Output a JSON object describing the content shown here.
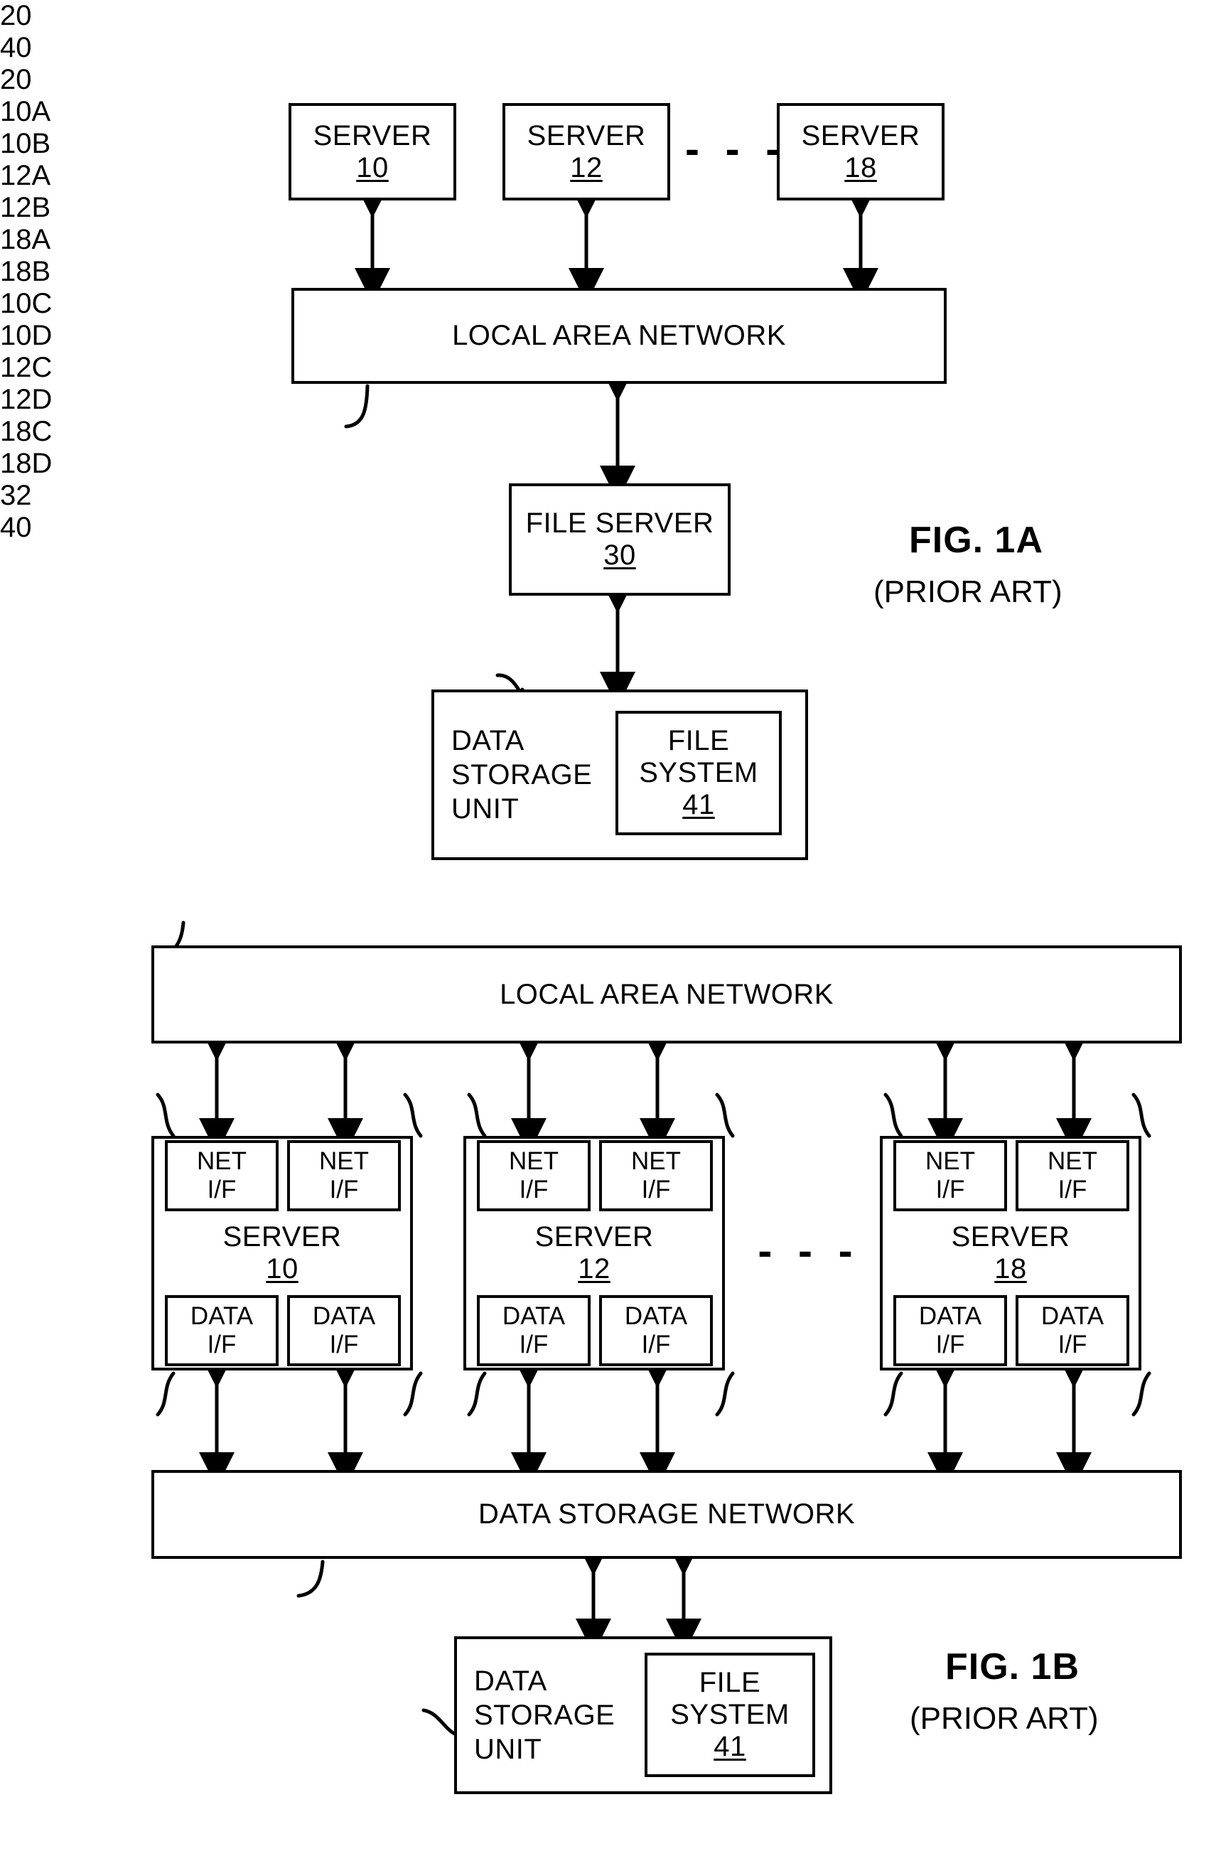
{
  "document": {
    "type": "patent-figure-sheet",
    "figures": [
      {
        "id": "fig-1a",
        "title": "FIG. 1A",
        "subtitle": "(PRIOR ART)"
      },
      {
        "id": "fig-1b",
        "title": "FIG. 1B",
        "subtitle": "(PRIOR ART)"
      }
    ]
  },
  "fig1a": {
    "servers": [
      {
        "label": "SERVER",
        "ref": "10"
      },
      {
        "label": "SERVER",
        "ref": "12"
      },
      {
        "label": "SERVER",
        "ref": "18"
      }
    ],
    "ellipsis": "- - -",
    "lan": {
      "label": "LOCAL AREA NETWORK",
      "ref": "20"
    },
    "file_server": {
      "label": "FILE SERVER",
      "ref": "30"
    },
    "storage_unit": {
      "line1": "DATA",
      "line2": "STORAGE",
      "line3": "UNIT",
      "ref": "40"
    },
    "file_system": {
      "line1": "FILE",
      "line2": "SYSTEM",
      "ref": "41"
    },
    "title": "FIG. 1A",
    "subtitle": "(PRIOR ART)"
  },
  "fig1b": {
    "lan": {
      "label": "LOCAL AREA NETWORK",
      "ref": "20"
    },
    "storage_network": {
      "label": "DATA STORAGE NETWORK",
      "ref": "32"
    },
    "ellipsis": "- - -",
    "net_if_label_line1": "NET",
    "net_if_label_line2": "I/F",
    "data_if_label_line1": "DATA",
    "data_if_label_line2": "I/F",
    "servers": [
      {
        "label": "SERVER",
        "ref": "10",
        "net_refs": [
          "10A",
          "10B"
        ],
        "data_refs": [
          "10C",
          "10D"
        ]
      },
      {
        "label": "SERVER",
        "ref": "12",
        "net_refs": [
          "12A",
          "12B"
        ],
        "data_refs": [
          "12C",
          "12D"
        ]
      },
      {
        "label": "SERVER",
        "ref": "18",
        "net_refs": [
          "18A",
          "18B"
        ],
        "data_refs": [
          "18C",
          "18D"
        ]
      }
    ],
    "storage_unit": {
      "line1": "DATA",
      "line2": "STORAGE",
      "line3": "UNIT",
      "ref": "40"
    },
    "file_system": {
      "line1": "FILE",
      "line2": "SYSTEM",
      "ref": "41"
    },
    "title": "FIG. 1B",
    "subtitle": "(PRIOR ART)"
  },
  "style": {
    "ink": "#000000",
    "paper": "#ffffff"
  }
}
